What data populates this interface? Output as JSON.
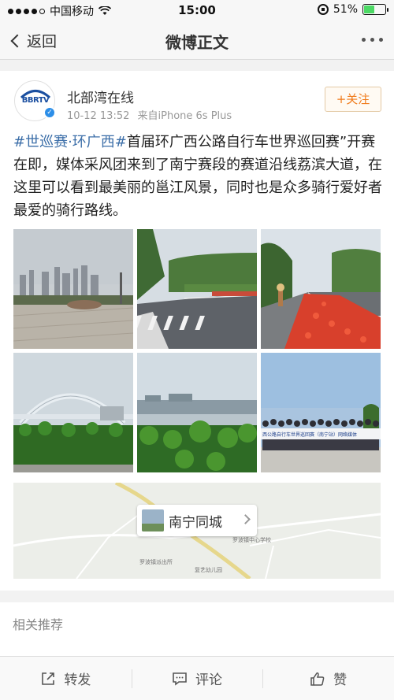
{
  "status_bar": {
    "carrier": "中国移动",
    "time": "15:00",
    "battery_percent": "51%",
    "battery_level": 0.51,
    "signal_bars": 4
  },
  "nav": {
    "back_label": "返回",
    "title": "微博正文"
  },
  "post": {
    "author": "北部湾在线",
    "avatar_text": "BBRTV",
    "time": "10-12 13:52",
    "source": "来自iPhone 6s Plus",
    "follow_label": "+关注",
    "topic": "#世巡赛·环广西#",
    "body": "首届环广西公路自行车世界巡回赛”开赛在即，媒体采风团来到了南宁赛段的赛道沿线荔滨大道，在这里可以看到最美丽的邕江风景，同时也是众多骑行爱好者最爱的骑行路线。",
    "banner_text": "西公路自行车世界巡回赛（南宁站）网络媒体"
  },
  "location": {
    "name": "南宁同城",
    "map_labels": [
      "罗波镇中心学校",
      "罗波镇派出所",
      "复艺幼儿园"
    ]
  },
  "related": {
    "title": "相关推荐"
  },
  "toolbar": {
    "repost_label": "转发",
    "comment_label": "评论",
    "like_label": "赞"
  },
  "colors": {
    "topic_link": "#3b6ea8",
    "follow": "#f07a1a",
    "battery": "#4cd964"
  }
}
